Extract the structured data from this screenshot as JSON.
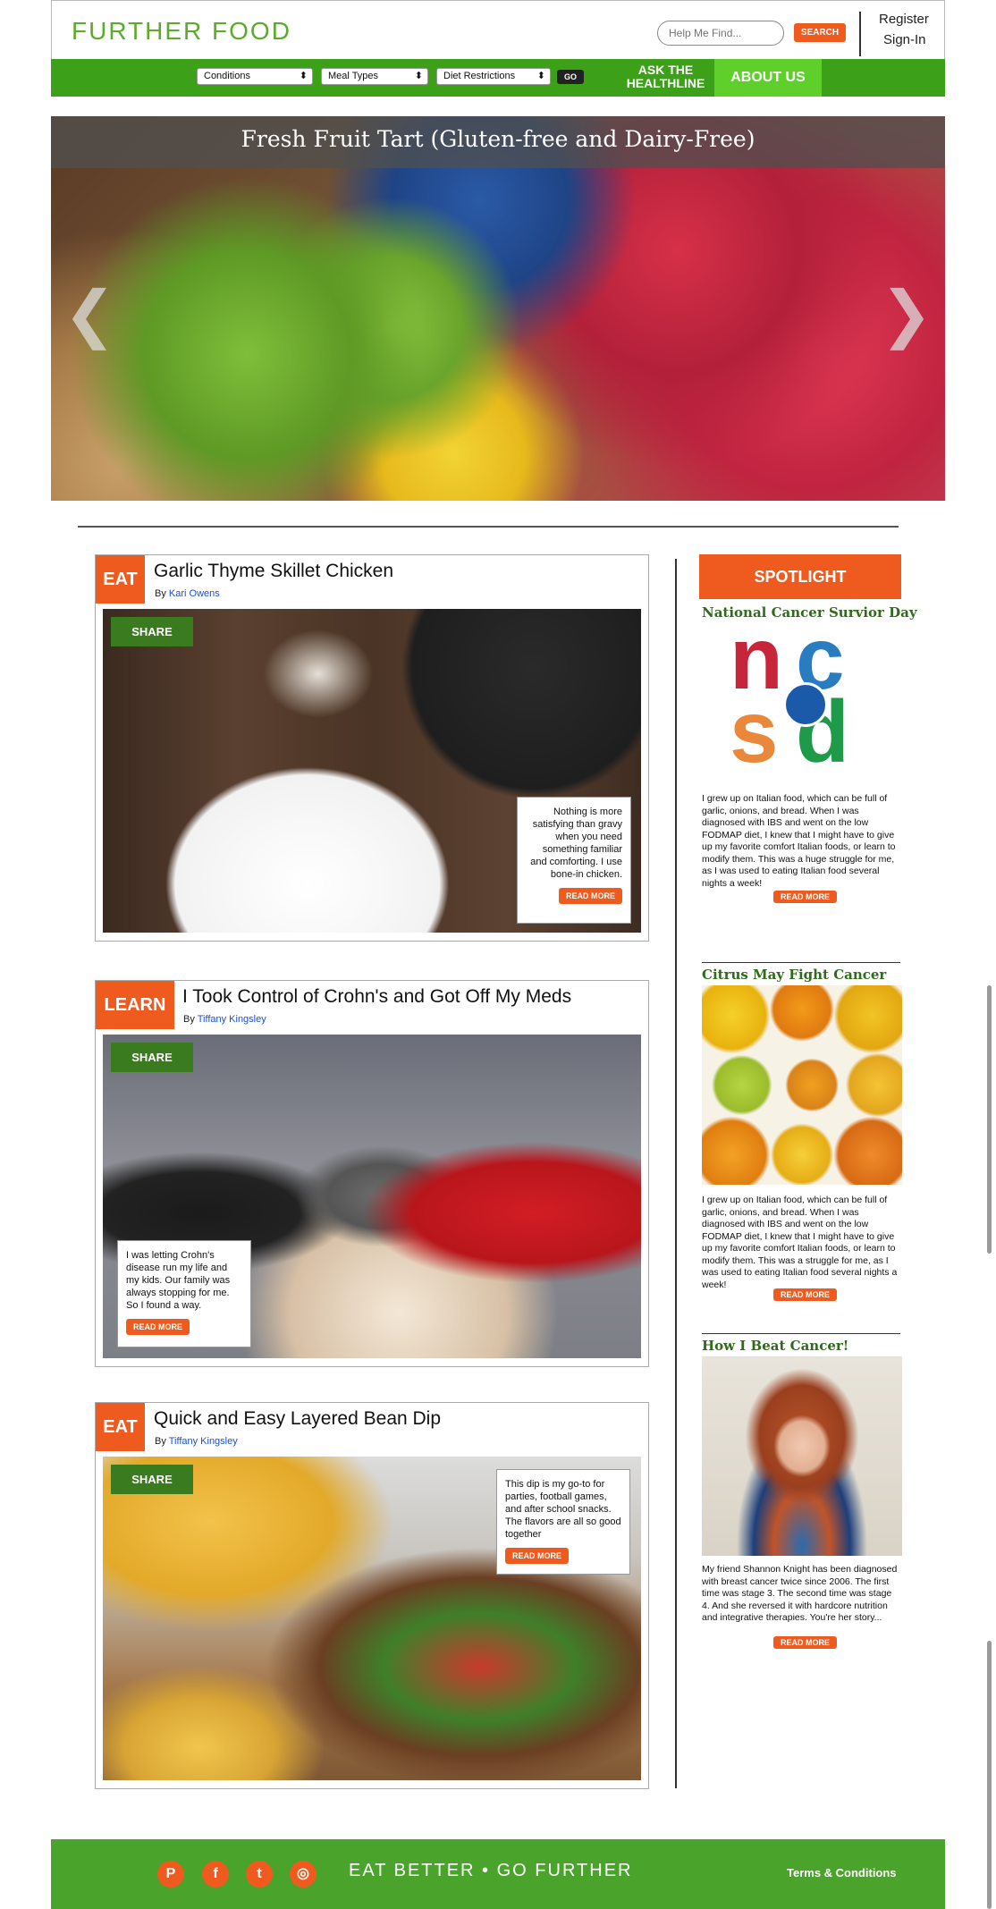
{
  "header": {
    "logo": "FURTHER FOOD",
    "search_placeholder": "Help Me Find...",
    "search_button": "SEARCH",
    "register": "Register",
    "signin": "Sign-In"
  },
  "nav": {
    "conditions": "Conditions",
    "meal_types": "Meal Types",
    "diet_restrictions": "Diet Restrictions",
    "go": "GO",
    "ask_line1": "ASK THE",
    "ask_line2": "HEALTHLINE",
    "about": "ABOUT US"
  },
  "hero": {
    "title": "Fresh Fruit Tart (Gluten-free and Dairy-Free)",
    "prev": "❮",
    "next": "❯"
  },
  "articles": [
    {
      "tag": "EAT",
      "title": "Garlic Thyme Skillet Chicken",
      "by": "By",
      "author": "Kari Owens",
      "share": "SHARE",
      "excerpt": "Nothing is more satisfying than gravy when you need something familiar and comforting. I use bone-in chicken.",
      "read_more": "READ MORE"
    },
    {
      "tag": "LEARN",
      "title": "I Took Control of Crohn's and Got Off My Meds",
      "by": "By",
      "author": "Tiffany Kingsley",
      "share": "SHARE",
      "excerpt": "I was letting Crohn's disease run my life and my kids. Our family was always stopping for me. So I found a way.",
      "read_more": "READ MORE"
    },
    {
      "tag": "EAT",
      "title": "Quick and Easy Layered Bean Dip",
      "by": "By",
      "author": "Tiffany Kingsley",
      "share": "SHARE",
      "excerpt": "This dip is my go-to for parties, football games, and after school snacks. The flavors are all so good together",
      "read_more": "READ MORE"
    }
  ],
  "sidebar": {
    "heading": "SPOTLIGHT",
    "items": [
      {
        "title": "National Cancer Survior Day",
        "text": "I grew up on Italian food, which can be full of garlic, onions, and bread. When I was diagnosed with IBS and went on the low FODMAP diet, I knew that I might have to give up my favorite comfort Italian foods, or learn to modify them. This was a huge struggle for me, as I was used to eating Italian food several nights a week!",
        "read_more": "READ MORE",
        "logo_letters": [
          "n",
          "c",
          "s",
          "d"
        ]
      },
      {
        "title": "Citrus May Fight Cancer",
        "text": "I grew up on Italian food, which can be full of garlic, onions, and bread. When I was diagnosed with IBS and went on the low FODMAP diet, I knew that I might have to give up my favorite comfort Italian foods, or learn to modify them. This was a struggle for me, as I was used to eating Italian food several nights a week!",
        "read_more": "READ MORE"
      },
      {
        "title": "How I Beat Cancer!",
        "text": "My friend Shannon Knight has been diagnosed with breast cancer twice since 2006. The first time was stage 3. The second time was stage 4. And she reversed it with hardcore nutrition and integrative therapies. You're  her story...",
        "read_more": "READ MORE"
      }
    ]
  },
  "footer": {
    "icons": [
      "pinterest-icon",
      "facebook-icon",
      "tumblr-icon",
      "instagram-icon"
    ],
    "icon_glyphs": [
      "P",
      "f",
      "t",
      "◎"
    ],
    "tagline": "EAT BETTER • GO FURTHER",
    "terms": "Terms & Conditions"
  },
  "colors": {
    "brand_green": "#3ca118",
    "accent_orange": "#ef5b1e",
    "about_green": "#5fcf2b",
    "sidebar_title_green": "#2f6b1a"
  }
}
